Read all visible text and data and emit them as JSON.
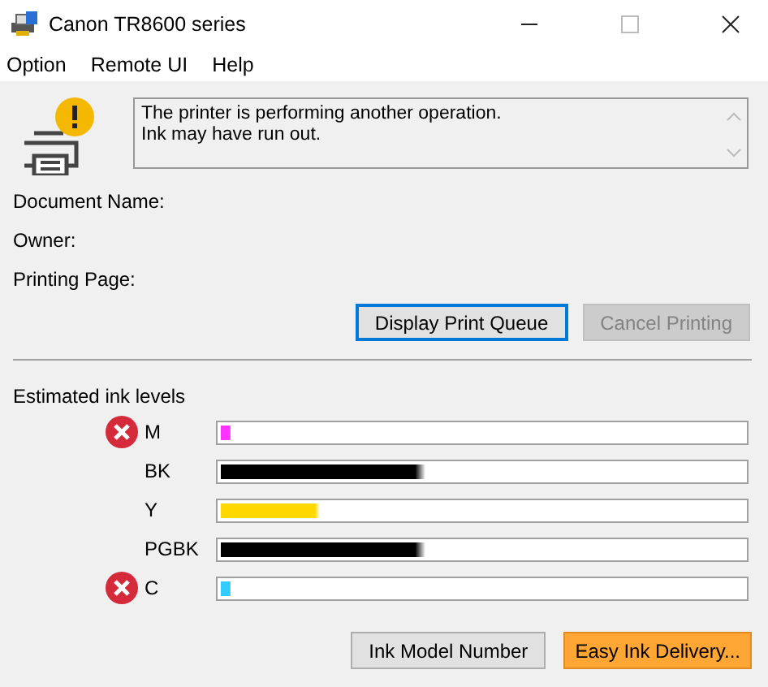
{
  "window": {
    "title": "Canon TR8600 series"
  },
  "menu": [
    "Option",
    "Remote UI",
    "Help"
  ],
  "status": {
    "message_lines": [
      "The printer is performing another operation.",
      "Ink may have run out."
    ],
    "warning": true
  },
  "job": [
    {
      "label": "Document Name:"
    },
    {
      "label": "Owner:"
    },
    {
      "label": "Printing Page:"
    }
  ],
  "job_buttons": [
    {
      "label": "Display Print Queue",
      "disabled": false,
      "focused": true
    },
    {
      "label": "Cancel Printing",
      "disabled": true,
      "focused": false
    }
  ],
  "ink_title": "Estimated ink levels",
  "inks": [
    {
      "name": "M",
      "error": true,
      "level": 0.02,
      "color": "#ff33ff"
    },
    {
      "name": "BK",
      "error": false,
      "level": 0.39,
      "color": "#000000"
    },
    {
      "name": "Y",
      "error": false,
      "level": 0.19,
      "color": "#ffd800"
    },
    {
      "name": "PGBK",
      "error": false,
      "level": 0.39,
      "color": "#000000"
    },
    {
      "name": "C",
      "error": true,
      "level": 0.02,
      "color": "#33ccff"
    }
  ],
  "bottom_buttons": [
    {
      "label": "Ink Model Number",
      "kind": "plain"
    },
    {
      "label": "Easy Ink Delivery...",
      "kind": "accent"
    }
  ]
}
